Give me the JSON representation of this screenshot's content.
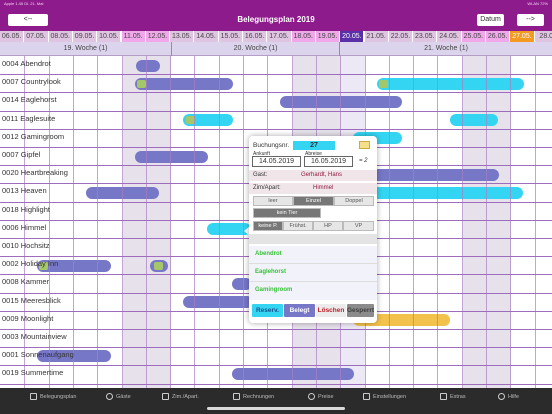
{
  "status": {
    "left": "Apple 1.45 Di. 21. Mai",
    "right": "WLAN 72%"
  },
  "header": {
    "prev_label": "<--",
    "title": "Belegungsplan 2019",
    "datum_label": "Datum",
    "next_label": "-->"
  },
  "days": [
    "06.05.",
    "07.05.",
    "08.05.",
    "09.05.",
    "10.05.",
    "11.05.",
    "12.05.",
    "13.05.",
    "14.05.",
    "15.05.",
    "16.05.",
    "17.05.",
    "18.05.",
    "19.05.",
    "20.05.",
    "21.05.",
    "22.05.",
    "23.05.",
    "24.05.",
    "25.05.",
    "26.05.",
    "27.05.",
    "28.0"
  ],
  "weeks": [
    "19. Woche (1)",
    "20. Woche (1)",
    "21. Woche (1)"
  ],
  "rooms": [
    "0004 Abendrot",
    "0007 Countrylook",
    "0014 Eaglehorst",
    "0011 Eaglesuite",
    "0012 Gamingroom",
    "0007 Gipfel",
    "0020 Heartbreaking",
    "0013 Heaven",
    "0018 Highlight",
    "0006 Himmel",
    "0010 Hochsitz",
    "0002 Holiday Inn",
    "0008 Kammer",
    "0015 Meeresblick",
    "0009 Moonlight",
    "0003 Mountainview",
    "0001 Sonnenaufgang",
    "0019 Summertime"
  ],
  "popup": {
    "buchungsnr_label": "Buchungsnr.",
    "buchungsnr": "27",
    "ankunft_label": "Ankunft",
    "ankunft": "14.05.2019",
    "abreise_label": "Abreise",
    "abreise": "16.05.2019",
    "nights": "= 2",
    "gast_label": "Gast:",
    "gast": "Gerhardt, Hans",
    "zim_label": "Zim/Apart:",
    "zim": "Himmel",
    "occupancy": [
      "leer",
      "Einzel",
      "Doppel"
    ],
    "animal": "kein Tier",
    "board": [
      "keine P.",
      "Frühst.",
      "HP",
      "VP"
    ],
    "list": [
      "Abendrot",
      "Eaglehorst",
      "Gamingroom"
    ],
    "buttons": [
      "Reserv.",
      "Belegt",
      "Löschen",
      "Gesperrt"
    ]
  },
  "tabs": [
    "Belegungsplan",
    "Gäste",
    "Zim./Apart.",
    "Rechnungen",
    "Preise",
    "Einstellungen",
    "Extras",
    "Hilfe"
  ],
  "colors": {
    "header": "#8e1b8c",
    "booking_dark": "#7777c8",
    "booking_cyan": "#34d5f2",
    "booking_orange": "#f2c24c",
    "today": "#5a2fa8",
    "highlight": "#f39a23"
  }
}
